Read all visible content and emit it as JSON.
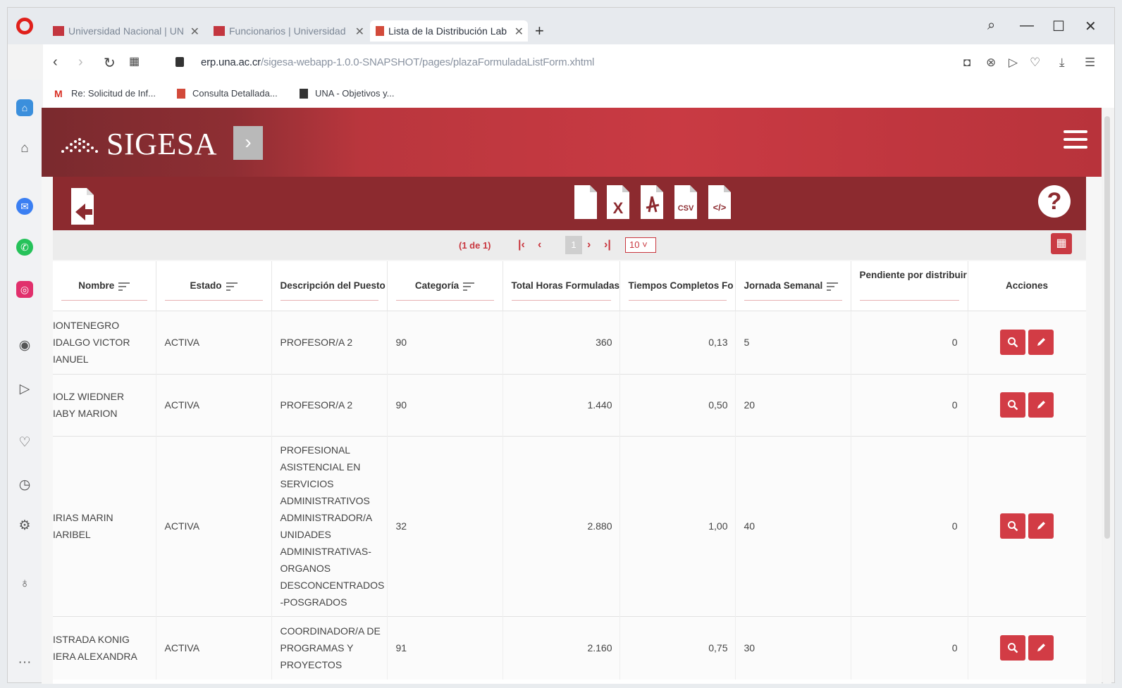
{
  "browser": {
    "tabs": [
      {
        "label": "Universidad Nacional | UN"
      },
      {
        "label": "Funcionarios | Universidad"
      },
      {
        "label": "Lista de la Distribución Lab",
        "active": true
      }
    ],
    "url_host": "erp.una.ac.cr",
    "url_path": "/sigesa-webapp-1.0.0-SNAPSHOT/pages/plazaFormuladaListForm.xhtml",
    "bookmarks": [
      {
        "label": "Re: Solicitud de Inf..."
      },
      {
        "label": "Consulta Detallada..."
      },
      {
        "label": "UNA - Objetivos y..."
      }
    ]
  },
  "app": {
    "title": "SIGESA",
    "export_icons": [
      "file-icon",
      "excel-icon",
      "pdf-icon",
      "csv-icon",
      "xml-icon"
    ],
    "export_labels": {
      "excel": "X",
      "csv": "CSV",
      "xml": "</>"
    },
    "help": "?"
  },
  "paginator": {
    "status": "(1 de 1)",
    "current_page": "1",
    "rows_per_page": "10"
  },
  "table": {
    "columns": [
      "Nombre",
      "Estado",
      "Descripción del Puesto",
      "Categoría",
      "Total Horas Formuladas",
      "Tiempos Completos Fo",
      "Jornada Semanal",
      "Pendiente por distribuir",
      "Acciones"
    ],
    "rows": [
      {
        "nombre": [
          "IONTENEGRO",
          "IDALGO VICTOR",
          "IANUEL"
        ],
        "estado": "ACTIVA",
        "descripcion": [
          "PROFESOR/A 2"
        ],
        "categoria": "90",
        "total_horas": "360",
        "tiempos_completos": "0,13",
        "jornada": "5",
        "pendiente": "0"
      },
      {
        "nombre": [
          "IOLZ WIEDNER",
          "IABY MARION"
        ],
        "estado": "ACTIVA",
        "descripcion": [
          "PROFESOR/A 2"
        ],
        "categoria": "90",
        "total_horas": "1.440",
        "tiempos_completos": "0,50",
        "jornada": "20",
        "pendiente": "0"
      },
      {
        "nombre": [
          "IRIAS MARIN",
          "IARIBEL"
        ],
        "estado": "ACTIVA",
        "descripcion": [
          "PROFESIONAL",
          "ASISTENCIAL EN",
          "SERVICIOS",
          "ADMINISTRATIVOS",
          "ADMINISTRADOR/A",
          "UNIDADES",
          "ADMINISTRATIVAS-",
          "ORGANOS",
          "DESCONCENTRADOS",
          "-POSGRADOS"
        ],
        "categoria": "32",
        "total_horas": "2.880",
        "tiempos_completos": "1,00",
        "jornada": "40",
        "pendiente": "0"
      },
      {
        "nombre": [
          "ISTRADA KONIG",
          "IERA ALEXANDRA"
        ],
        "estado": "ACTIVA",
        "descripcion": [
          "COORDINADOR/A DE",
          "PROGRAMAS Y",
          "PROYECTOS"
        ],
        "categoria": "91",
        "total_horas": "2.160",
        "tiempos_completos": "0,75",
        "jornada": "30",
        "pendiente": "0"
      }
    ]
  }
}
